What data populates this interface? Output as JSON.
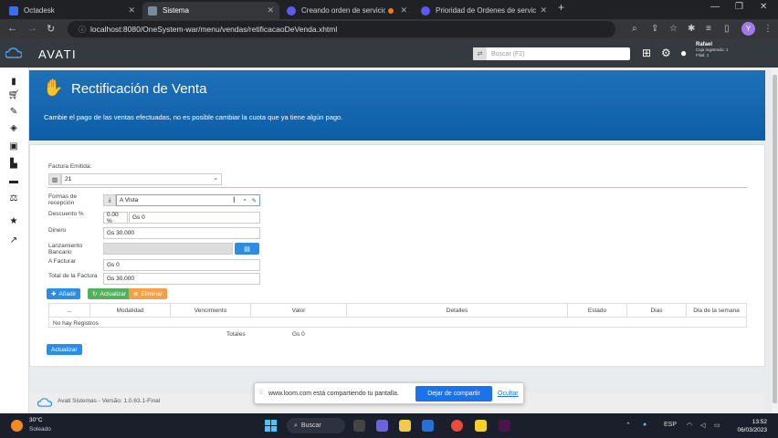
{
  "browser": {
    "tabs": [
      {
        "label": "Octadesk",
        "active": false
      },
      {
        "label": "Sistema",
        "active": true
      },
      {
        "label": "Creando orden de servicio",
        "active": false
      },
      {
        "label": "Prioridad de Ordenes de servicio",
        "active": false
      }
    ],
    "url": "localhost:8080/OneSystem-war/menu/vendas/retificacaoDeVenda.xhtml",
    "profile_initial": "Y"
  },
  "app": {
    "brand": "AVATI",
    "search_placeholder": "Buscar (F2)",
    "user": {
      "name": "Rafael",
      "line1": "Caja registrado: 1",
      "line2": "Filial: 1"
    }
  },
  "banner": {
    "title": "Rectificación de Venta",
    "description": "Cambie el pago de las ventas efectuadas, no es posible cambiar la cuota que ya tiene algún pago."
  },
  "form": {
    "factura_label": "Factura Emitida:",
    "factura_value": "21",
    "formas_label": "Formas de recepción",
    "formas_value": "A Vista",
    "descuento_label": "Descuento %",
    "descuento_pct": "0.00 %",
    "descuento_amount": "Gs 0",
    "dinero_label": "Dinero",
    "dinero_value": "Gs 30.000",
    "lanzamiento_label": "Lanzamiento Bancario",
    "afacturar_label": "A Facturar",
    "afacturar_value": "Gs 0",
    "total_label": "Total de la Factura",
    "total_value": "Gs 30.000"
  },
  "actions": {
    "add": "Añadir",
    "update": "Actualizar",
    "delete": "Eliminar",
    "bottom_update": "Actualizar"
  },
  "table": {
    "columns": [
      "...",
      "Modalidad",
      "Vencimiento",
      "Valor",
      "Detalles",
      "Estado",
      "Dias",
      "Dia de la semana"
    ],
    "empty": "No hay Registros",
    "totals_label": "Totales",
    "totals_value": "Gs 0"
  },
  "footer": {
    "text": "Avati Sistemas - Versão: 1.0.63.1-Final"
  },
  "loom": {
    "text": "www.loom.com está compartiendo tu pantalla.",
    "stop": "Dejar de compartir",
    "hide": "Ocultar"
  },
  "taskbar": {
    "temp": "30°C",
    "condition": "Soleado",
    "search": "Buscar",
    "lang": "ESP",
    "time": "13:52",
    "date": "06/03/2023"
  }
}
